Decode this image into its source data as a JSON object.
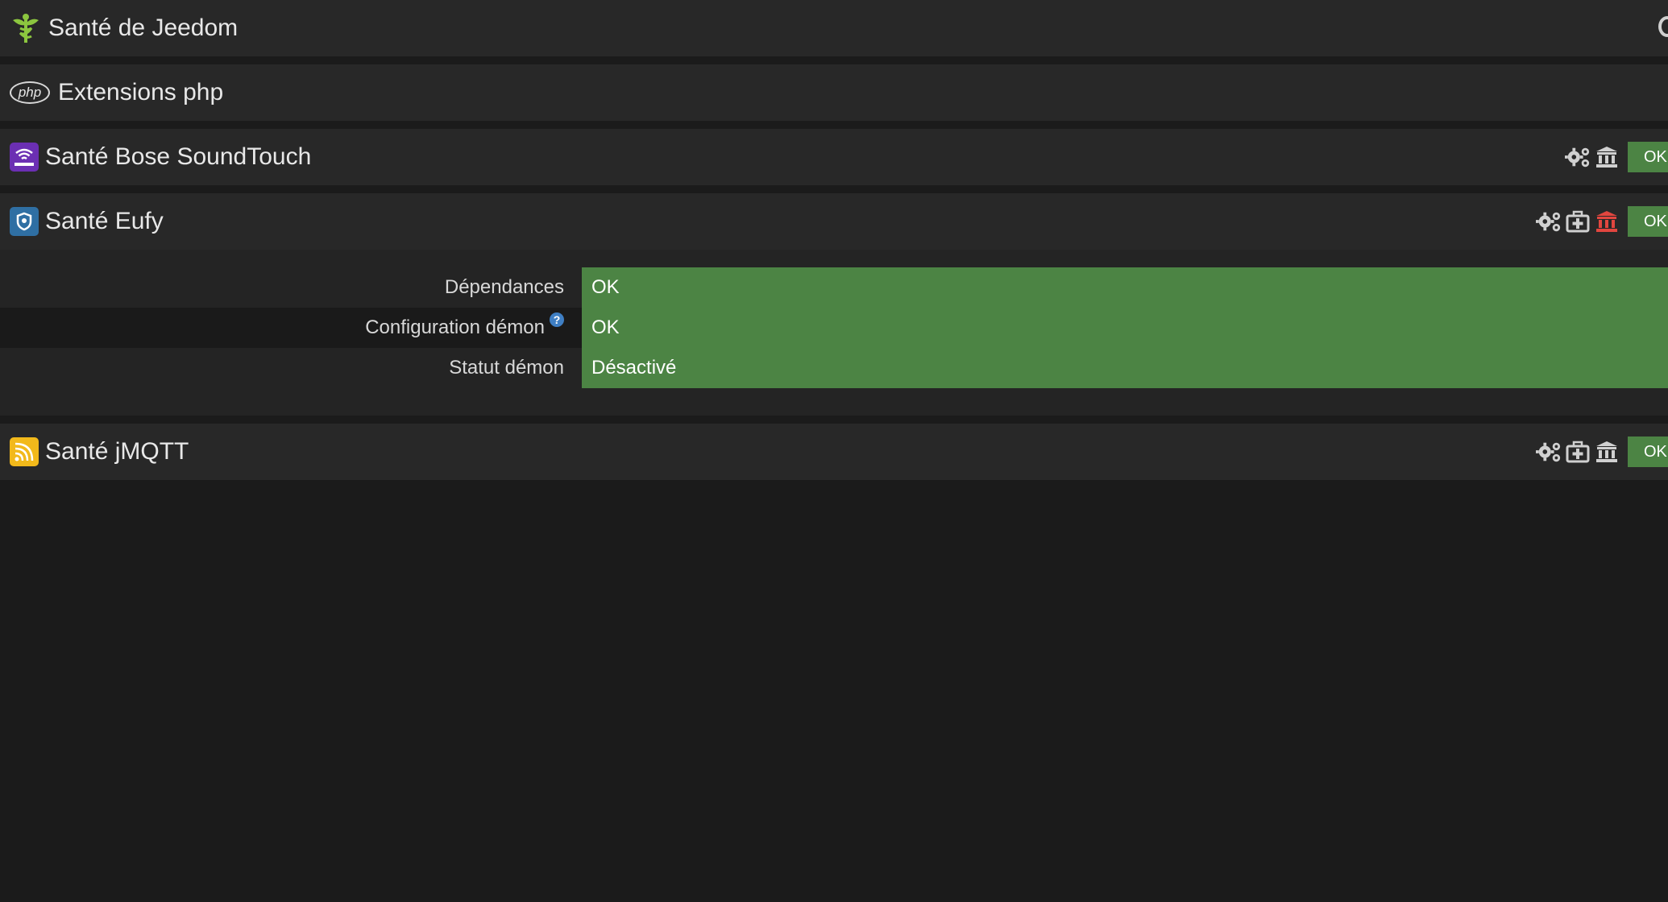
{
  "header": {
    "title": "Santé de Jeedom"
  },
  "php_section": {
    "badge": "php",
    "title": "Extensions php"
  },
  "plugins": [
    {
      "title": "Santé Bose SoundTouch",
      "icon": "bose-wifi-icon",
      "status": "OK"
    },
    {
      "title": "Santé Eufy",
      "icon": "eufy-shield-icon",
      "status": "OK",
      "details": [
        {
          "label": "Dépendances",
          "value": "OK"
        },
        {
          "label": "Configuration démon",
          "help": "?",
          "value": "OK"
        },
        {
          "label": "Statut démon",
          "value": "Désactivé"
        }
      ]
    },
    {
      "title": "Santé jMQTT",
      "icon": "jmqtt-signal-icon",
      "status": "OK"
    }
  ],
  "colors": {
    "ok_green": "#4c8444",
    "danger_red": "#e2463f",
    "accent_green": "#8cc63f"
  }
}
